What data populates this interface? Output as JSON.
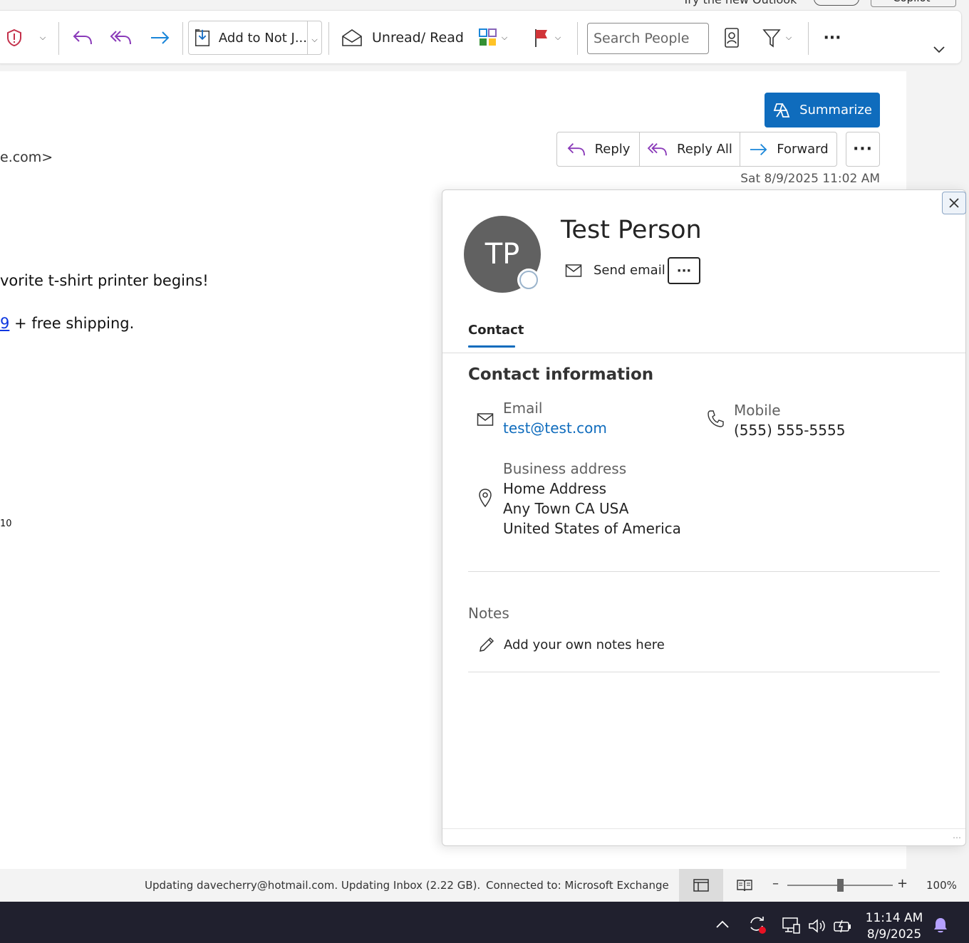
{
  "top": {
    "try_new_label": "Try the new Outlook",
    "copilot_label": "Copilot"
  },
  "ribbon": {
    "add_to_notebook_label": "Add to Not J...",
    "unread_read_label": "Unread/ Read",
    "search_people_placeholder": "Search People",
    "more_label": "···",
    "colors": {
      "report": "#c4314b",
      "reply": "#8a3ab9",
      "forward": "#1a86d9",
      "flag": "#d13438"
    }
  },
  "message": {
    "sender_fragment": "e.com>",
    "body_line1": "vorite t-shirt printer begins!",
    "body_link": "9",
    "body_line2_rest": " + free shipping.",
    "small_text": "10",
    "summarize_label": "Summarize",
    "reply_label": "Reply",
    "reply_all_label": "Reply All",
    "forward_label": "Forward",
    "more_actions_label": "···",
    "datetime": "Sat 8/9/2025 11:02 AM"
  },
  "contact_card": {
    "initials": "TP",
    "name": "Test Person",
    "send_email_label": "Send email",
    "more_label": "···",
    "tab_label": "Contact",
    "section_title": "Contact information",
    "email_label": "Email",
    "email_value": "test@test.com",
    "mobile_label": "Mobile",
    "mobile_value": "(555) 555-5555",
    "business_address_label": "Business address",
    "address_line1": "Home Address",
    "address_line2": "Any Town CA USA",
    "address_line3": "United States of America",
    "notes_label": "Notes",
    "notes_placeholder": "Add your own notes here"
  },
  "status_bar": {
    "updating_text": "Updating davecherry@hotmail.com.  Updating Inbox (2.22 GB).",
    "connection_text": "Connected to: Microsoft Exchange",
    "zoom_percent": "100%",
    "zoom_level": 0.5
  },
  "taskbar": {
    "time": "11:14 AM",
    "date": "8/9/2025"
  }
}
